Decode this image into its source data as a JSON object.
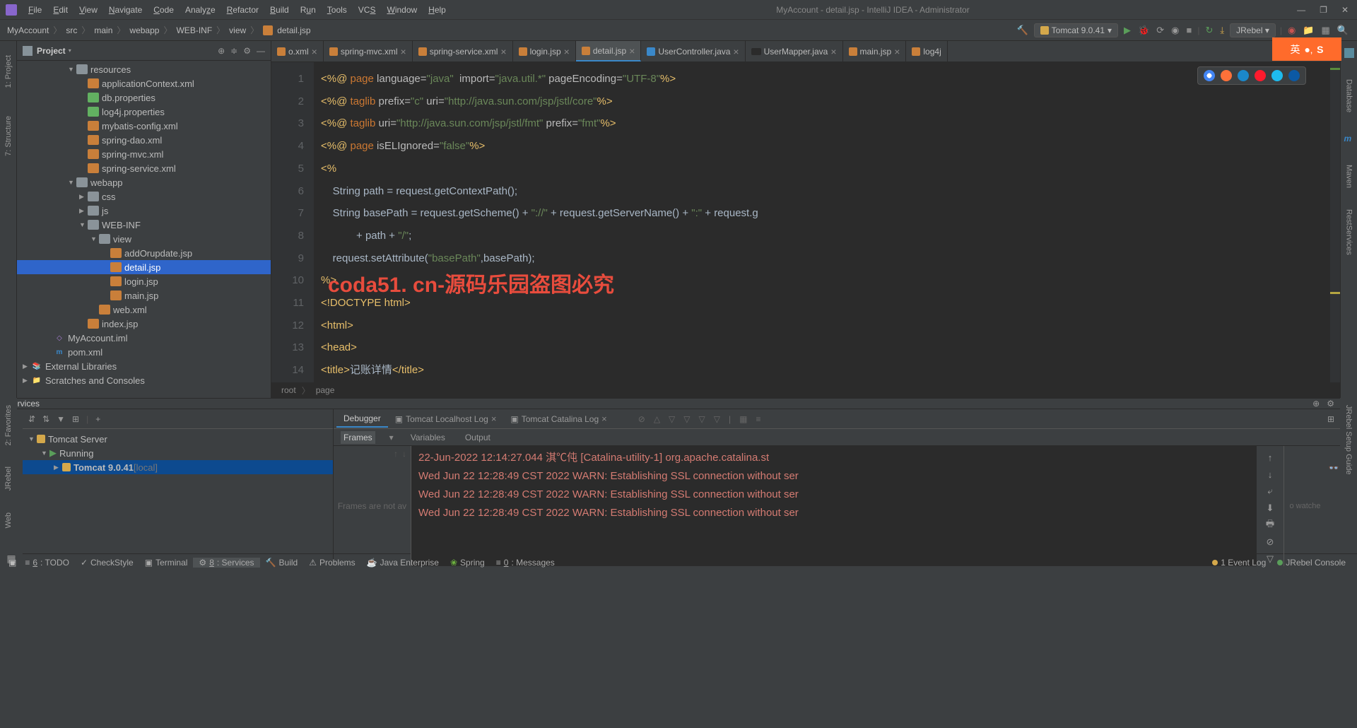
{
  "title_bar": {
    "title": "MyAccount - detail.jsp - IntelliJ IDEA - Administrator",
    "menus": [
      "File",
      "Edit",
      "View",
      "Navigate",
      "Code",
      "Analyze",
      "Refactor",
      "Build",
      "Run",
      "Tools",
      "VCS",
      "Window",
      "Help"
    ]
  },
  "breadcrumb": [
    "MyAccount",
    "src",
    "main",
    "webapp",
    "WEB-INF",
    "view",
    "detail.jsp"
  ],
  "run_config": "Tomcat 9.0.41",
  "jrebel_btn": "JRebel",
  "project_panel": {
    "title": "Project",
    "tree": [
      {
        "depth": 4,
        "arrow": "▼",
        "icon": "folder-res",
        "label": "resources"
      },
      {
        "depth": 5,
        "arrow": "",
        "icon": "xml",
        "label": "applicationContext.xml"
      },
      {
        "depth": 5,
        "arrow": "",
        "icon": "prop",
        "label": "db.properties"
      },
      {
        "depth": 5,
        "arrow": "",
        "icon": "prop",
        "label": "log4j.properties"
      },
      {
        "depth": 5,
        "arrow": "",
        "icon": "xml",
        "label": "mybatis-config.xml"
      },
      {
        "depth": 5,
        "arrow": "",
        "icon": "xml",
        "label": "spring-dao.xml"
      },
      {
        "depth": 5,
        "arrow": "",
        "icon": "xml",
        "label": "spring-mvc.xml"
      },
      {
        "depth": 5,
        "arrow": "",
        "icon": "xml",
        "label": "spring-service.xml"
      },
      {
        "depth": 4,
        "arrow": "▼",
        "icon": "folder",
        "label": "webapp"
      },
      {
        "depth": 5,
        "arrow": "▶",
        "icon": "folder",
        "label": "css"
      },
      {
        "depth": 5,
        "arrow": "▶",
        "icon": "folder",
        "label": "js"
      },
      {
        "depth": 5,
        "arrow": "▼",
        "icon": "folder",
        "label": "WEB-INF"
      },
      {
        "depth": 6,
        "arrow": "▼",
        "icon": "folder",
        "label": "view"
      },
      {
        "depth": 7,
        "arrow": "",
        "icon": "jsp",
        "label": "addOrupdate.jsp"
      },
      {
        "depth": 7,
        "arrow": "",
        "icon": "jsp",
        "label": "detail.jsp",
        "selected": true
      },
      {
        "depth": 7,
        "arrow": "",
        "icon": "jsp",
        "label": "login.jsp"
      },
      {
        "depth": 7,
        "arrow": "",
        "icon": "jsp",
        "label": "main.jsp"
      },
      {
        "depth": 6,
        "arrow": "",
        "icon": "xml",
        "label": "web.xml"
      },
      {
        "depth": 5,
        "arrow": "",
        "icon": "jsp",
        "label": "index.jsp"
      },
      {
        "depth": 2,
        "arrow": "",
        "icon": "iml",
        "label": "MyAccount.iml"
      },
      {
        "depth": 2,
        "arrow": "",
        "icon": "pom",
        "label": "pom.xml"
      },
      {
        "depth": 0,
        "arrow": "▶",
        "icon": "lib",
        "label": "External Libraries"
      },
      {
        "depth": 0,
        "arrow": "▶",
        "icon": "scratch",
        "label": "Scratches and Consoles"
      }
    ]
  },
  "left_gutter": [
    "1: Project",
    "7: Structure"
  ],
  "left_gutter2": [
    "2: Favorites",
    "JRebel",
    "Web"
  ],
  "right_gutter": [
    "Database",
    "Maven",
    "RestServices"
  ],
  "editor_tabs": [
    {
      "icon": "xml",
      "label": "o.xml",
      "close": true
    },
    {
      "icon": "xml",
      "label": "spring-mvc.xml",
      "close": true
    },
    {
      "icon": "xml",
      "label": "spring-service.xml",
      "close": true
    },
    {
      "icon": "jsp",
      "label": "login.jsp",
      "close": true
    },
    {
      "icon": "jsp",
      "label": "detail.jsp",
      "close": true,
      "active": true
    },
    {
      "icon": "java",
      "label": "UserController.java",
      "close": true
    },
    {
      "icon": "mapper",
      "label": "UserMapper.java",
      "close": true
    },
    {
      "icon": "jsp",
      "label": "main.jsp",
      "close": true
    },
    {
      "icon": "jsp",
      "label": "log4j"
    }
  ],
  "code_lines": [
    "1",
    "2",
    "3",
    "4",
    "5",
    "6",
    "7",
    "8",
    "9",
    "10",
    "11",
    "12",
    "13",
    "14"
  ],
  "code_breadcrumb": [
    "root",
    "page"
  ],
  "watermark": "coda51. cn-源码乐园盗图必究",
  "services": {
    "title": "Services",
    "tree": [
      {
        "arrow": "▼",
        "icon": "tomcat",
        "label": "Tomcat Server"
      },
      {
        "arrow": "▼",
        "icon": "run",
        "label": "Running",
        "depth": 1
      },
      {
        "arrow": "▶",
        "icon": "tomcat",
        "label": "Tomcat 9.0.41",
        "suffix": "[local]",
        "depth": 2,
        "selected": true
      }
    ],
    "output_tabs": [
      {
        "label": "Debugger",
        "active": true
      },
      {
        "label": "Tomcat Localhost Log",
        "icon": true,
        "close": true
      },
      {
        "label": "Tomcat Catalina Log",
        "icon": true,
        "close": true
      }
    ],
    "subtabs": [
      "Frames",
      "Variables",
      "Output"
    ],
    "frames_text": "Frames are not av",
    "watch_text": "o watche",
    "console": [
      "22-Jun-2022 12:14:27.044 淇℃伅 [Catalina-utility-1] org.apache.catalina.st",
      "Wed Jun 22 12:28:49 CST 2022 WARN: Establishing SSL connection without ser",
      "Wed Jun 22 12:28:49 CST 2022 WARN: Establishing SSL connection without ser",
      "Wed Jun 22 12:28:49 CST 2022 WARN: Establishing SSL connection without ser"
    ]
  },
  "status_bar": {
    "left": [
      {
        "num": "6",
        "label": ": TODO"
      },
      {
        "icon": "✓",
        "label": "CheckStyle"
      },
      {
        "icon": "▣",
        "label": "Terminal"
      },
      {
        "icon": "⚙",
        "num": "8",
        "label": ": Services",
        "active": true
      },
      {
        "icon": "🔨",
        "label": "Build"
      },
      {
        "icon": "⚠",
        "label": "Problems"
      },
      {
        "icon": "☕",
        "label": "Java Enterprise"
      },
      {
        "icon": "❀",
        "label": "Spring"
      },
      {
        "icon": "≡",
        "num": "0",
        "label": ": Messages"
      }
    ],
    "right": [
      {
        "label": "1 Event Log",
        "dot": "orange"
      },
      {
        "label": "JRebel Console",
        "dot": "green"
      }
    ]
  },
  "lang_indicator": "英"
}
